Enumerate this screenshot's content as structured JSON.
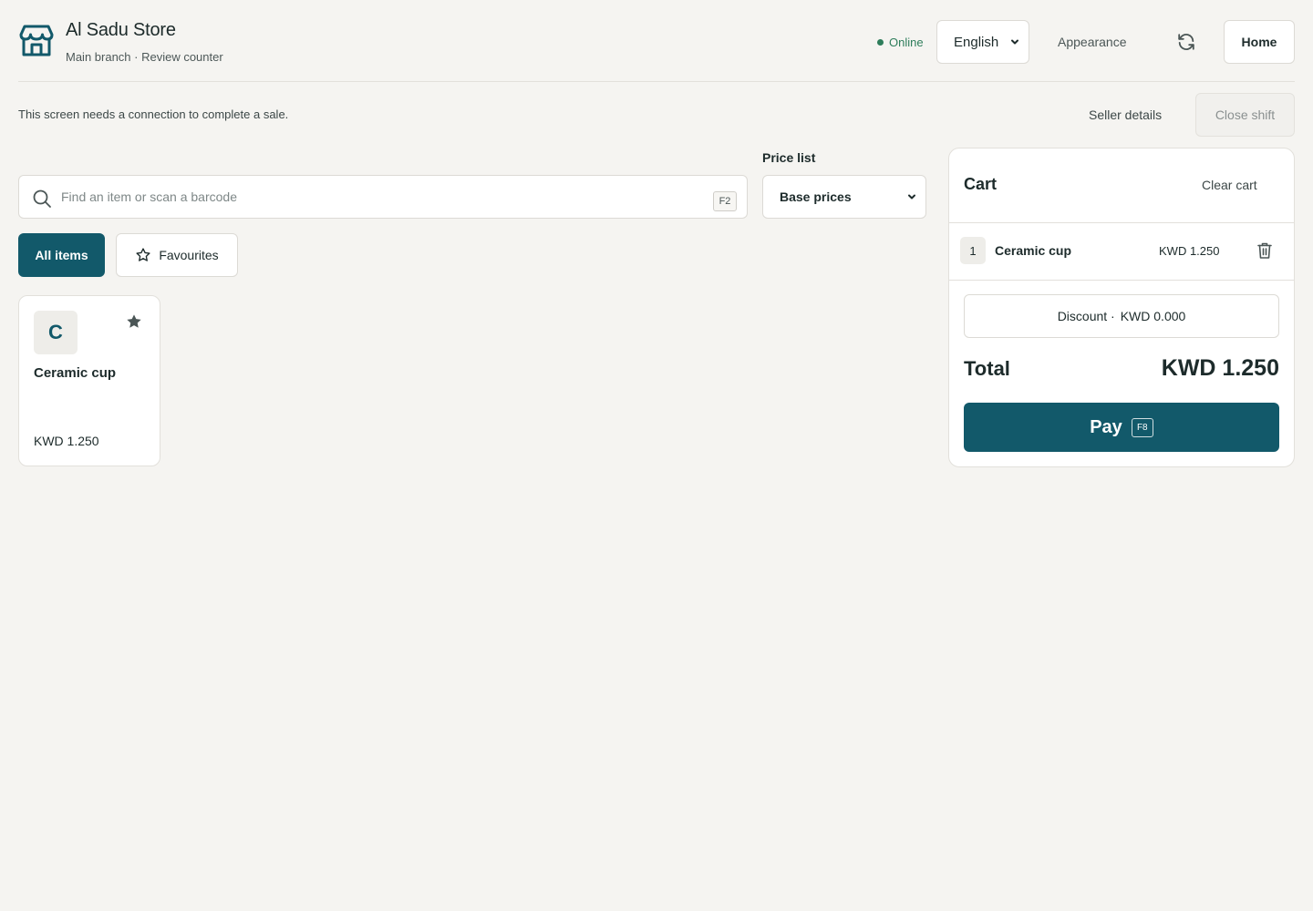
{
  "header": {
    "store_name": "Al Sadu Store",
    "store_sub": "Main branch · Review counter",
    "status": "Online",
    "language": "English",
    "appearance": "Appearance",
    "home": "Home",
    "icons": {
      "logo": "storefront-icon",
      "refresh": "refresh-icon"
    }
  },
  "notice": {
    "text": "This screen needs a connection to complete a sale.",
    "seller_details": "Seller details",
    "close_shift": "Close shift"
  },
  "search": {
    "placeholder": "Find an item or scan a barcode",
    "shortcut": "F2"
  },
  "price_list": {
    "label": "Price list",
    "selected": "Base prices"
  },
  "tabs": {
    "all": "All items",
    "favourites": "Favourites"
  },
  "products": [
    {
      "initial": "C",
      "name": "Ceramic cup",
      "price": "KWD 1.250",
      "favourite": true
    }
  ],
  "cart": {
    "title": "Cart",
    "clear": "Clear cart",
    "lines": [
      {
        "qty": "1",
        "name": "Ceramic cup",
        "price": "KWD 1.250"
      }
    ],
    "discount_label": "Discount ·",
    "discount_value": "KWD 0.000",
    "total_label": "Total",
    "total_value": "KWD 1.250",
    "pay_label": "Pay",
    "pay_shortcut": "F8"
  },
  "colors": {
    "accent": "#12596a",
    "online": "#2e7d5b",
    "background": "#f5f4f1"
  }
}
